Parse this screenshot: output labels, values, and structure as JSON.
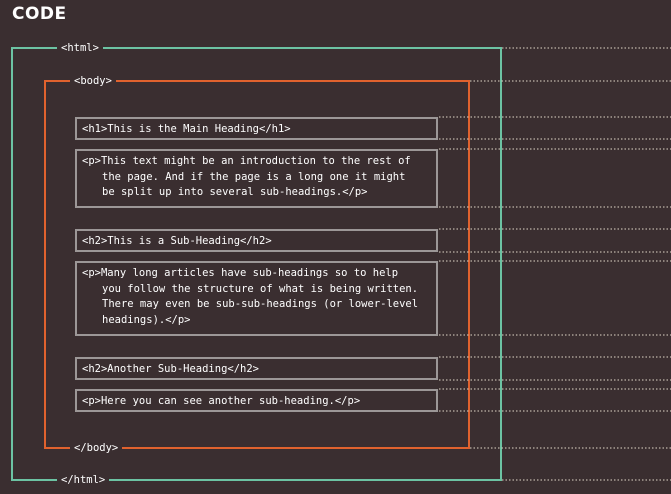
{
  "title": "CODE",
  "colors": {
    "background": "#3a2e30",
    "html_frame": "#6cc3a3",
    "body_frame": "#e0622e",
    "element_box": "#9c9797",
    "guide_dots": "#e0d8c8"
  },
  "tags": {
    "html_open": "<html>",
    "body_open": "<body>",
    "body_close": "</body>",
    "html_close": "</html>"
  },
  "elements": [
    {
      "lines": [
        "<h1>This is the Main Heading</h1>"
      ]
    },
    {
      "lines": [
        "<p>This text might be an introduction to the rest of",
        "the page. And if the page is a long one it might",
        "be split up into several sub-headings.</p>"
      ]
    },
    {
      "lines": [
        "<h2>This is a Sub-Heading</h2>"
      ]
    },
    {
      "lines": [
        "<p>Many long articles have sub-headings so to help",
        "you follow the structure of what is being written.",
        "There may even be sub-sub-headings (or lower-level",
        "headings).</p>"
      ]
    },
    {
      "lines": [
        "<h2>Another Sub-Heading</h2>"
      ]
    },
    {
      "lines": [
        "<p>Here you can see another sub-heading.</p>"
      ]
    }
  ]
}
